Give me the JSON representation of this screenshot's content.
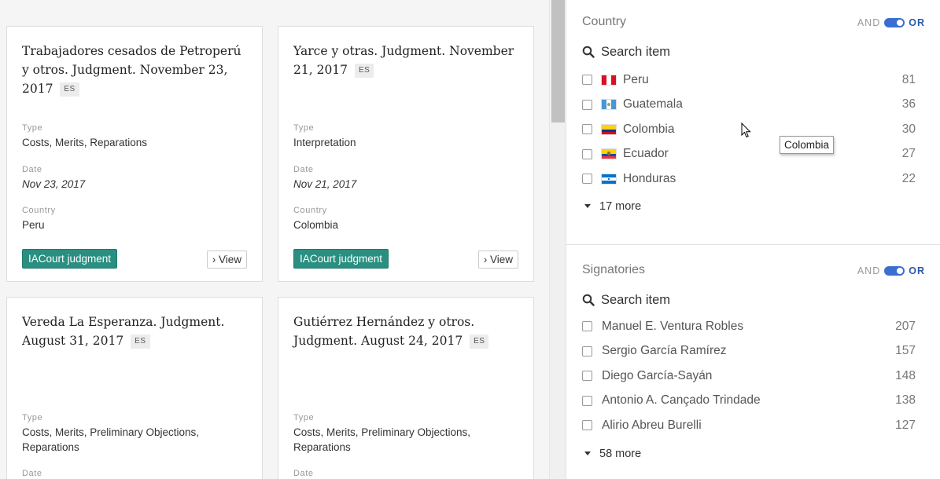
{
  "cards": [
    {
      "title": "Trabajadores cesados de Petroperú y otros. Judgment. November 23, 2017",
      "lang": "ES",
      "type_label": "Type",
      "type_value": "Costs, Merits, Reparations",
      "date_label": "Date",
      "date_value": "Nov 23, 2017",
      "country_label": "Country",
      "country_value": "Peru",
      "tag": "IACourt judgment",
      "view_label": "› View"
    },
    {
      "title": "Yarce y otras. Judgment. November 21, 2017",
      "lang": "ES",
      "type_label": "Type",
      "type_value": "Interpretation",
      "date_label": "Date",
      "date_value": "Nov 21, 2017",
      "country_label": "Country",
      "country_value": "Colombia",
      "tag": "IACourt judgment",
      "view_label": "› View"
    },
    {
      "title": "Vereda La Esperanza. Judgment. August 31, 2017",
      "lang": "ES",
      "type_label": "Type",
      "type_value": "Costs, Merits, Preliminary Objections, Reparations",
      "date_label": "Date"
    },
    {
      "title": "Gutiérrez Hernández y otros. Judgment. August 24, 2017",
      "lang": "ES",
      "type_label": "Type",
      "type_value": "Costs, Merits, Preliminary Objections, Reparations",
      "date_label": "Date"
    }
  ],
  "filters": {
    "country": {
      "title": "Country",
      "and_label": "AND",
      "or_label": "OR",
      "search_placeholder": "Search item",
      "options": [
        {
          "label": "Peru",
          "count": "81",
          "flag": "peru"
        },
        {
          "label": "Guatemala",
          "count": "36",
          "flag": "guatemala"
        },
        {
          "label": "Colombia",
          "count": "30",
          "flag": "colombia"
        },
        {
          "label": "Ecuador",
          "count": "27",
          "flag": "ecuador"
        },
        {
          "label": "Honduras",
          "count": "22",
          "flag": "honduras"
        }
      ],
      "more_label": "17 more"
    },
    "signatories": {
      "title": "Signatories",
      "and_label": "AND",
      "or_label": "OR",
      "search_placeholder": "Search item",
      "options": [
        {
          "label": "Manuel E. Ventura Robles",
          "count": "207"
        },
        {
          "label": "Sergio García Ramírez",
          "count": "157"
        },
        {
          "label": "Diego García-Sayán",
          "count": "148"
        },
        {
          "label": "Antonio A. Cançado Trindade",
          "count": "138"
        },
        {
          "label": "Alirio Abreu Burelli",
          "count": "127"
        }
      ],
      "more_label": "58 more"
    }
  },
  "tooltip": "Colombia",
  "colors": {
    "tag_bg": "#2a8f81",
    "toggle_on": "#3a6fd0",
    "or_text": "#2a5aa8"
  }
}
